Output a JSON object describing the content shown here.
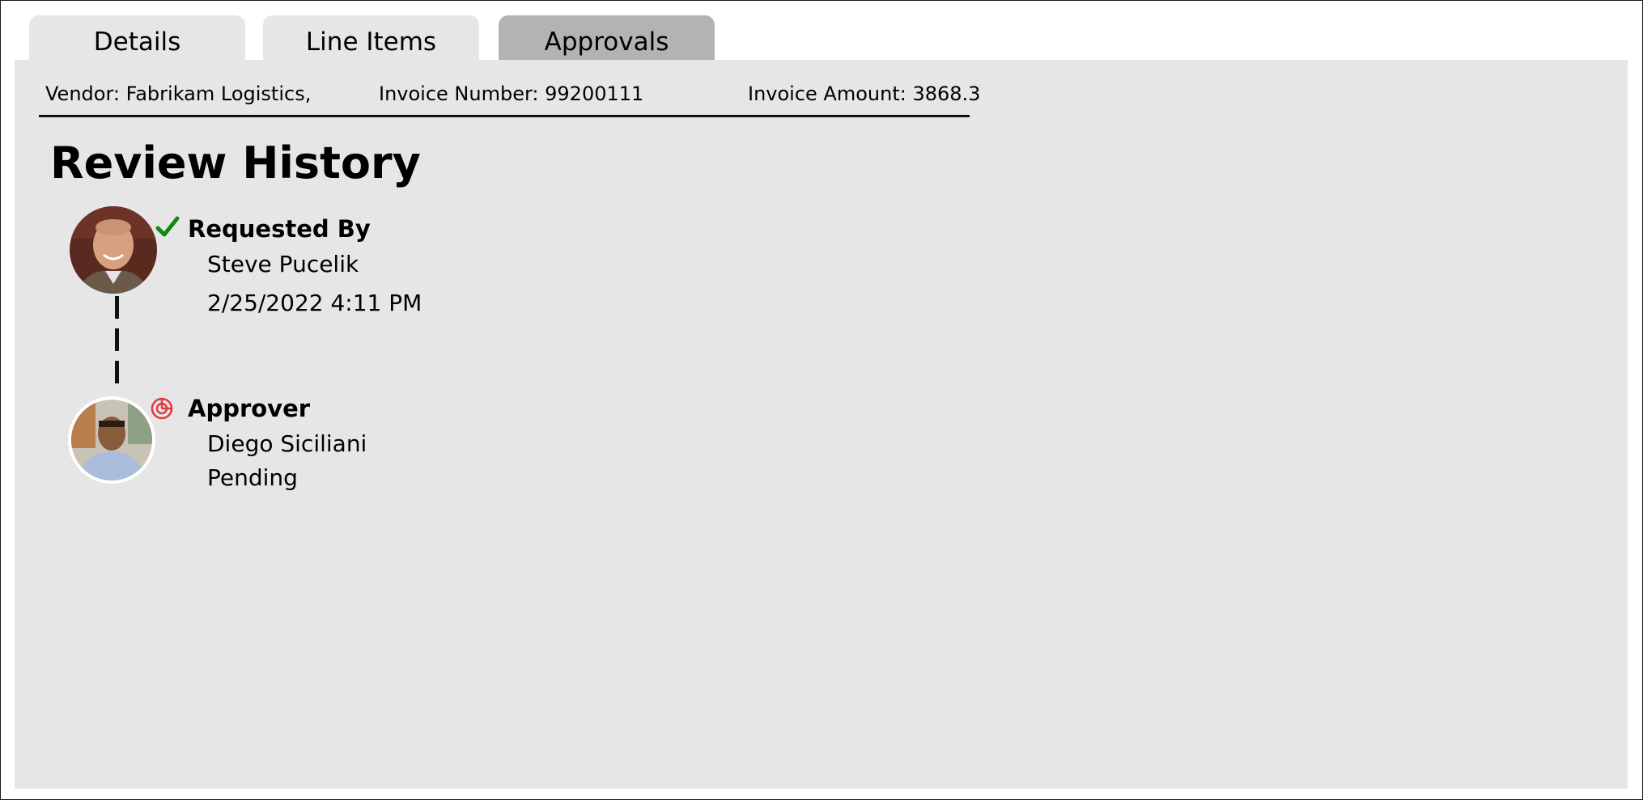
{
  "tabs": [
    {
      "label": "Details",
      "active": false
    },
    {
      "label": "Line Items",
      "active": false
    },
    {
      "label": "Approvals",
      "active": true
    }
  ],
  "invoice": {
    "vendor": "Vendor: Fabrikam Logistics,",
    "number": "Invoice Number: 99200111",
    "amount": "Invoice Amount: 3868.3"
  },
  "review": {
    "title": "Review History",
    "steps": [
      {
        "role": "Requested By",
        "name": "Steve Pucelik",
        "detail": "2/25/2022 4:11 PM",
        "status_icon": "checkmark-icon",
        "status_color": "#0f8a0f"
      },
      {
        "role": "Approver",
        "name": "Diego Siciliani",
        "detail": "Pending",
        "status_icon": "pending-icon",
        "status_color": "#e0393e"
      }
    ]
  }
}
